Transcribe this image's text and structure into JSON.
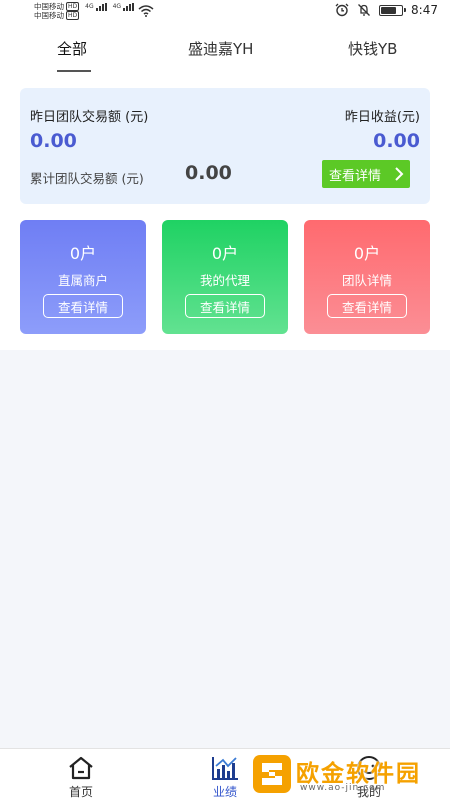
{
  "status_bar": {
    "carrier_1": "中国移动",
    "carrier_2": "中国移动",
    "hd_badge": "HD",
    "network": "4G",
    "time": "8:47",
    "icons": [
      "signal-bars-icon",
      "wifi-icon",
      "alarm-icon",
      "mute-icon",
      "battery-icon"
    ]
  },
  "tabs": [
    {
      "label": "全部",
      "active": true
    },
    {
      "label": "盛迪嘉YH",
      "active": false
    },
    {
      "label": "快钱YB",
      "active": false
    }
  ],
  "summary": {
    "yesterday_volume_label": "昨日团队交易额 (元)",
    "yesterday_volume_value": "0.00",
    "yesterday_income_label": "昨日收益(元)",
    "yesterday_income_value": "0.00",
    "cumulative_label": "累计团队交易额 (元)",
    "cumulative_value": "0.00",
    "detail_button": "查看详情",
    "accent_color": "#4a5bd1",
    "button_color": "#5cc926"
  },
  "cards": [
    {
      "count": "0户",
      "label": "直属商户",
      "button": "查看详情",
      "color": "#6f7ef4"
    },
    {
      "count": "0户",
      "label": "我的代理",
      "button": "查看详情",
      "color": "#1fd263"
    },
    {
      "count": "0户",
      "label": "团队详情",
      "button": "查看详情",
      "color": "#ff6a6f"
    }
  ],
  "bottom_nav": [
    {
      "label": "首页",
      "icon": "home-icon",
      "active": false
    },
    {
      "label": "业绩",
      "icon": "chart-icon",
      "active": true
    },
    {
      "label": "我的",
      "icon": "profile-icon",
      "active": false
    }
  ],
  "watermark": {
    "text": "欧金软件园",
    "url": "www.ao-jin.com"
  }
}
